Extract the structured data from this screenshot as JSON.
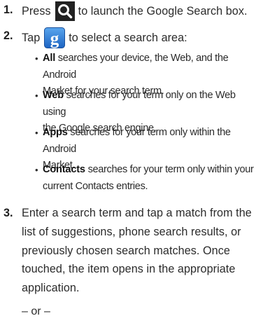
{
  "steps": [
    {
      "number": "1.",
      "before": "Press",
      "after": "to launch the Google Search box.",
      "icon": "search-icon"
    },
    {
      "number": "2.",
      "before": "Tap",
      "after": "to select a search area:",
      "icon": "google-g-icon"
    },
    {
      "number": "3.",
      "lines": [
        "Enter a search term and tap a match from the",
        "list of suggestions, phone search results, or",
        "previously chosen search matches. Once",
        "touched, the item opens in the appropriate",
        "application."
      ]
    }
  ],
  "bullets": [
    {
      "term": "All",
      "line1": "searches your device, the Web, and the Android",
      "line2": "Market for your search term.",
      "obscured_fragment": "searches"
    },
    {
      "term": "Web",
      "line1": "searches for your term only on the Web using",
      "line2": "the Google search engine."
    },
    {
      "term": "Apps",
      "line1": "searches for your term only within the Android",
      "line2": "Market."
    },
    {
      "term": "Contacts",
      "line1": "searches for your term only within your",
      "line2": "current Contacts entries."
    }
  ],
  "or_separator": "– or –",
  "colors": {
    "text": "#2b2b2b",
    "icon_dark": "#222222",
    "google_blue": "#2f7fd6"
  }
}
